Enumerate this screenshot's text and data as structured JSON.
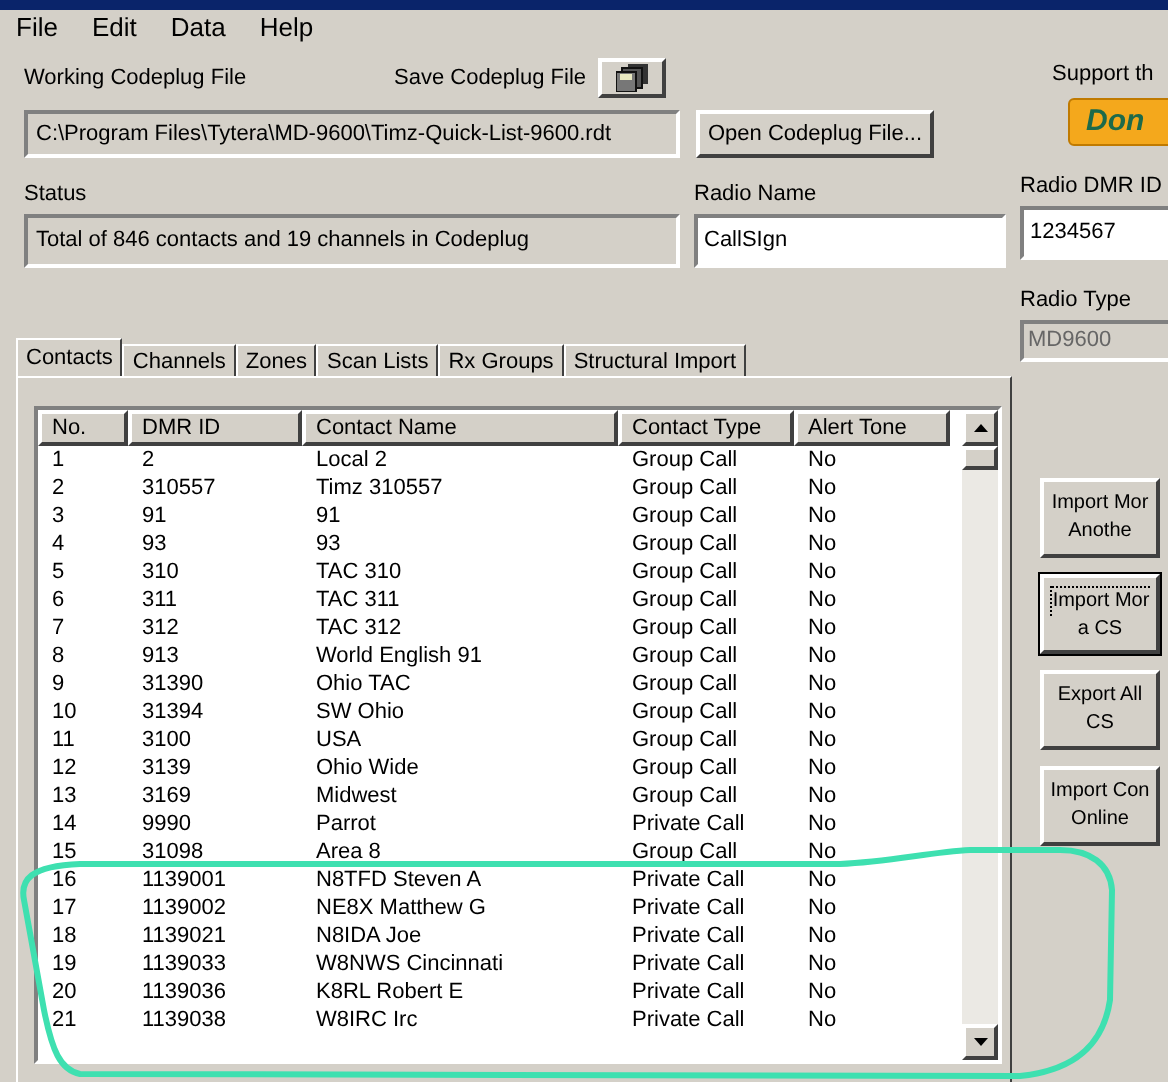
{
  "menu": [
    "File",
    "Edit",
    "Data",
    "Help"
  ],
  "working_file": {
    "label": "Working Codeplug File",
    "value": "C:\\Program Files\\Tytera\\MD-9600\\Timz-Quick-List-9600.rdt"
  },
  "save_label": "Save Codeplug File",
  "open_button": "Open Codeplug File...",
  "status": {
    "label": "Status",
    "value": "Total of 846 contacts and 19 channels in Codeplug"
  },
  "radio_name": {
    "label": "Radio Name",
    "value": "CallSIgn"
  },
  "support": {
    "label": "Support th",
    "button": "Don"
  },
  "radio_dmr_id": {
    "label": "Radio DMR ID",
    "value": "1234567"
  },
  "radio_type": {
    "label": "Radio Type",
    "value": "MD9600",
    "disabled": true
  },
  "tabs": [
    {
      "label": "Contacts",
      "selected": true
    },
    {
      "label": "Channels",
      "selected": false
    },
    {
      "label": "Zones",
      "selected": false
    },
    {
      "label": "Scan Lists",
      "selected": false
    },
    {
      "label": "Rx Groups",
      "selected": false
    },
    {
      "label": "Structural Import",
      "selected": false
    }
  ],
  "table": {
    "columns": [
      "No.",
      "DMR ID",
      "Contact Name",
      "Contact Type",
      "Alert Tone"
    ],
    "rows": [
      [
        "1",
        "2",
        "Local 2",
        "Group Call",
        "No"
      ],
      [
        "2",
        "310557",
        "Timz 310557",
        "Group Call",
        "No"
      ],
      [
        "3",
        "91",
        "91",
        "Group Call",
        "No"
      ],
      [
        "4",
        "93",
        "93",
        "Group Call",
        "No"
      ],
      [
        "5",
        "310",
        "TAC 310",
        "Group Call",
        "No"
      ],
      [
        "6",
        "311",
        "TAC 311",
        "Group Call",
        "No"
      ],
      [
        "7",
        "312",
        "TAC 312",
        "Group Call",
        "No"
      ],
      [
        "8",
        "913",
        "World English 91",
        "Group Call",
        "No"
      ],
      [
        "9",
        "31390",
        "Ohio TAC",
        "Group Call",
        "No"
      ],
      [
        "10",
        "31394",
        "SW Ohio",
        "Group Call",
        "No"
      ],
      [
        "11",
        "3100",
        "USA",
        "Group Call",
        "No"
      ],
      [
        "12",
        "3139",
        "Ohio Wide",
        "Group Call",
        "No"
      ],
      [
        "13",
        "3169",
        "Midwest",
        "Group Call",
        "No"
      ],
      [
        "14",
        "9990",
        "Parrot",
        "Private Call",
        "No"
      ],
      [
        "15",
        "31098",
        "Area 8",
        "Group Call",
        "No"
      ],
      [
        "16",
        "1139001",
        "N8TFD Steven A",
        "Private Call",
        "No"
      ],
      [
        "17",
        "1139002",
        "NE8X Matthew G",
        "Private Call",
        "No"
      ],
      [
        "18",
        "1139021",
        "N8IDA Joe",
        "Private Call",
        "No"
      ],
      [
        "19",
        "1139033",
        "W8NWS Cincinnati",
        "Private Call",
        "No"
      ],
      [
        "20",
        "1139036",
        "K8RL Robert E",
        "Private Call",
        "No"
      ],
      [
        "21",
        "1139038",
        "W8IRC Irc",
        "Private Call",
        "No"
      ]
    ]
  },
  "side_buttons": [
    {
      "lines": [
        "Import Mor",
        "Anothe"
      ],
      "focused": false
    },
    {
      "lines": [
        "Import Mor",
        "a CS"
      ],
      "focused": true
    },
    {
      "lines": [
        "Export All",
        "CS"
      ],
      "focused": false
    },
    {
      "lines": [
        "Import Con",
        "Online"
      ],
      "focused": false
    }
  ]
}
